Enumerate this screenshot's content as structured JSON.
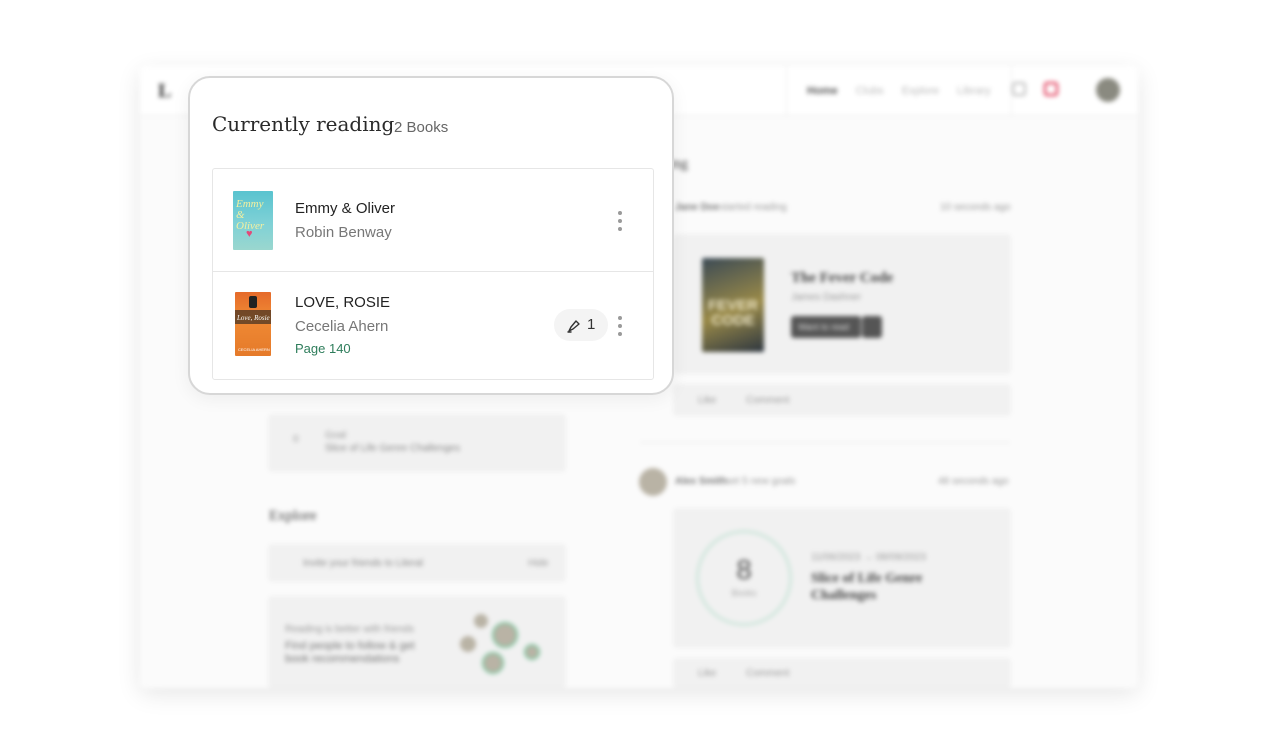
{
  "background": {
    "logo": "L",
    "nav": [
      "Home",
      "Clubs",
      "Explore",
      "Library"
    ],
    "feed_heading_fragment": "wing",
    "post1": {
      "actor": "Jane Doe",
      "action": "started reading",
      "time": "10 seconds ago",
      "book_title": "The Fever Code",
      "book_author": "James Dashner",
      "cover_text": "FEVER CODE",
      "button": "Want to read",
      "like": "Like",
      "comment": "Comment"
    },
    "post2": {
      "actor": "Alex Smith",
      "action": "set 5 new goals",
      "time": "48 seconds ago",
      "goal_number": "8",
      "goal_unit": "Books",
      "dates": "11/06/2023 → 08/09/2023",
      "goal_title": "Slice of Life Genre Challenges",
      "like": "Like",
      "comment": "Comment"
    },
    "left_goal": {
      "label": "Goal",
      "title": "Slice of Life Genre Challenges",
      "num": "0"
    },
    "explore": {
      "heading": "Explore",
      "invite": "Invite your friends to Literal",
      "hide": "Hide",
      "promo_small": "Reading is better with friends",
      "promo_big": "Find people to follow & get book recommendations"
    }
  },
  "popup": {
    "title": "Currently reading",
    "count": "2 Books",
    "books": [
      {
        "title": "Emmy & Oliver",
        "author": "Robin Benway",
        "cover_text": "Emmy & Oliver"
      },
      {
        "title": "LOVE, ROSIE",
        "author": "Cecelia Ahern",
        "page": "Page 140",
        "notes_count": "1",
        "cover_text": "Love, Rosie",
        "cover_author": "CECELIA AHERN"
      }
    ]
  },
  "colors": {
    "accent_green": "#2e7d5b",
    "notification_red": "#dd2244"
  }
}
